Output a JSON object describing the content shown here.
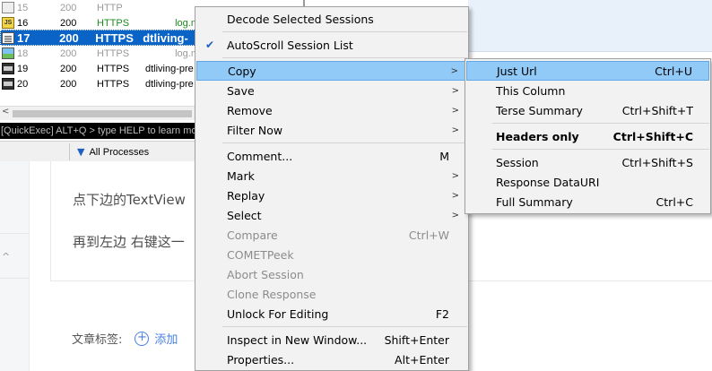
{
  "fiddler": {
    "sessions": [
      {
        "num": "15",
        "result": "200",
        "protocol": "HTTP",
        "host": "",
        "icon": "lock-icon",
        "style": "dim"
      },
      {
        "num": "16",
        "result": "200",
        "protocol": "HTTPS",
        "host": "log.m",
        "icon": "js-icon",
        "style": "https-green"
      },
      {
        "num": "17",
        "result": "200",
        "protocol": "HTTPS",
        "host": "dtliving-",
        "icon": "document-icon",
        "style": "selected"
      },
      {
        "num": "18",
        "result": "200",
        "protocol": "HTTPS",
        "host": "log.m",
        "icon": "image-icon",
        "style": "dim"
      },
      {
        "num": "19",
        "result": "200",
        "protocol": "HTTPS",
        "host": "dtliving-pre",
        "icon": "film-icon",
        "style": "normal"
      },
      {
        "num": "20",
        "result": "200",
        "protocol": "HTTPS",
        "host": "dtliving-pre",
        "icon": "film-icon",
        "style": "normal"
      }
    ],
    "quickexec": "[QuickExec] ALT+Q > type HELP to learn more",
    "process_filter": "All Processes"
  },
  "article": {
    "line1": "点下边的TextView",
    "line2": "再到左边 右键这一",
    "tags_label": "文章标签:",
    "add_tag": "添加"
  },
  "context_menu": {
    "items": [
      {
        "label": "Decode Selected Sessions",
        "shortcut": "",
        "submenu": false,
        "state": "normal"
      },
      {
        "label": "AutoScroll Session List",
        "shortcut": "",
        "submenu": false,
        "state": "checked"
      },
      {
        "label": "Copy",
        "shortcut": "",
        "submenu": true,
        "state": "highlighted"
      },
      {
        "label": "Save",
        "shortcut": "",
        "submenu": true,
        "state": "normal"
      },
      {
        "label": "Remove",
        "shortcut": "",
        "submenu": true,
        "state": "normal"
      },
      {
        "label": "Filter Now",
        "shortcut": "",
        "submenu": true,
        "state": "normal"
      },
      {
        "label": "Comment...",
        "shortcut": "M",
        "submenu": false,
        "state": "normal"
      },
      {
        "label": "Mark",
        "shortcut": "",
        "submenu": true,
        "state": "normal"
      },
      {
        "label": "Replay",
        "shortcut": "",
        "submenu": true,
        "state": "normal"
      },
      {
        "label": "Select",
        "shortcut": "",
        "submenu": true,
        "state": "normal"
      },
      {
        "label": "Compare",
        "shortcut": "Ctrl+W",
        "submenu": false,
        "state": "disabled"
      },
      {
        "label": "COMETPeek",
        "shortcut": "",
        "submenu": false,
        "state": "disabled"
      },
      {
        "label": "Abort Session",
        "shortcut": "",
        "submenu": false,
        "state": "disabled"
      },
      {
        "label": "Clone Response",
        "shortcut": "",
        "submenu": false,
        "state": "disabled"
      },
      {
        "label": "Unlock For Editing",
        "shortcut": "F2",
        "submenu": false,
        "state": "normal"
      },
      {
        "label": "Inspect in New Window...",
        "shortcut": "Shift+Enter",
        "submenu": false,
        "state": "normal"
      },
      {
        "label": "Properties...",
        "shortcut": "Alt+Enter",
        "submenu": false,
        "state": "normal"
      }
    ]
  },
  "copy_submenu": {
    "items": [
      {
        "label": "Just Url",
        "shortcut": "Ctrl+U",
        "state": "highlighted"
      },
      {
        "label": "This Column",
        "shortcut": "",
        "state": "normal"
      },
      {
        "label": "Terse Summary",
        "shortcut": "Ctrl+Shift+T",
        "state": "normal"
      },
      {
        "label": "Headers only",
        "shortcut": "Ctrl+Shift+C",
        "state": "bold"
      },
      {
        "label": "Session",
        "shortcut": "Ctrl+Shift+S",
        "state": "normal"
      },
      {
        "label": "Response DataURI",
        "shortcut": "",
        "state": "normal"
      },
      {
        "label": "Full Summary",
        "shortcut": "Ctrl+C",
        "state": "normal"
      }
    ]
  },
  "colors": {
    "selection": "#0a64c8",
    "menu_highlight": "#91c9f7",
    "link_blue": "#4a7fe0"
  }
}
